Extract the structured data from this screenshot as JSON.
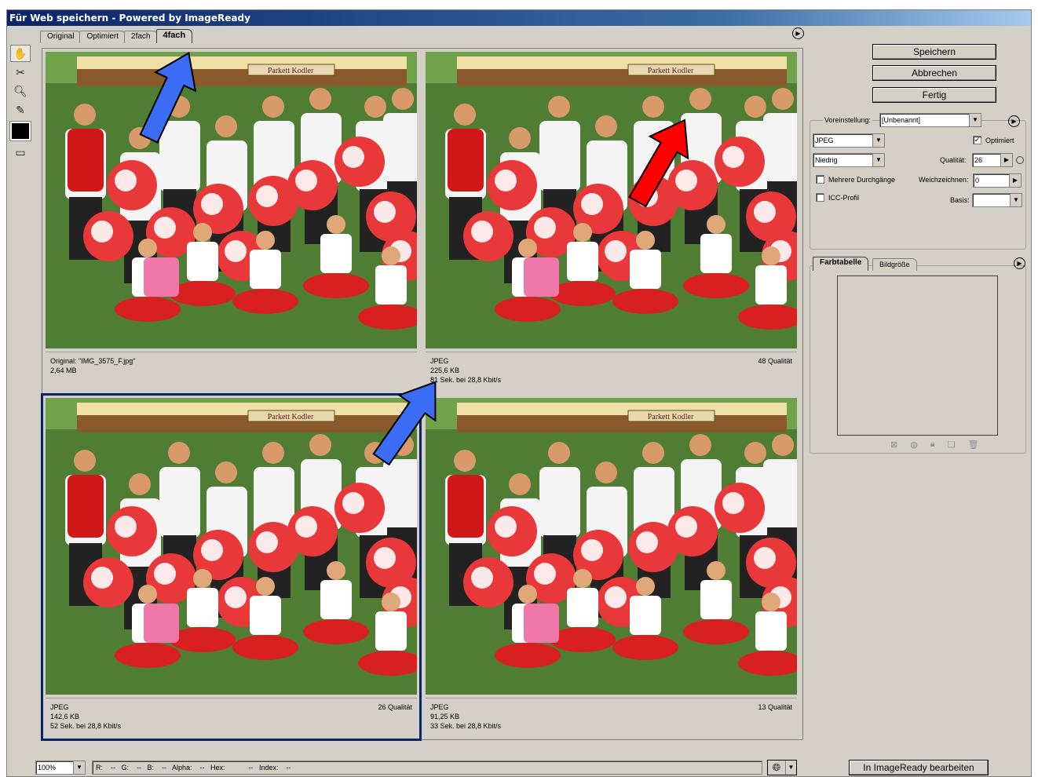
{
  "window": {
    "title": "Für Web speichern - Powered by ImageReady"
  },
  "tabs": [
    "Original",
    "Optimiert",
    "2fach",
    "4fach"
  ],
  "active_tab": "4fach",
  "panes": [
    {
      "line1": "Original: \"IMG_3575_F.jpg\"",
      "line2": "2,64 MB",
      "line3": "",
      "quality": ""
    },
    {
      "line1": "JPEG",
      "line2": "225,6 KB",
      "line3": "81 Sek. bei 28,8 Kbit/s",
      "quality": "48 Qualität"
    },
    {
      "line1": "JPEG",
      "line2": "142,6 KB",
      "line3": "52 Sek. bei 28,8 Kbit/s",
      "quality": "26 Qualität"
    },
    {
      "line1": "JPEG",
      "line2": "91,25 KB",
      "line3": "33 Sek. bei 28,8 Kbit/s",
      "quality": "13 Qualität"
    }
  ],
  "buttons": {
    "save": "Speichern",
    "cancel": "Abbrechen",
    "done": "Fertig",
    "imageready": "In ImageReady bearbeiten"
  },
  "settings": {
    "preset_label": "Voreinstellung:",
    "preset_value": "[Unbenannt]",
    "format": "JPEG",
    "quality_preset": "Niedrig",
    "optimized_label": "Optimiert",
    "optimized_checked": true,
    "quality_label": "Qualität:",
    "quality_value": "26",
    "progressive_label": "Mehrere Durchgänge",
    "blur_label": "Weichzeichnen:",
    "blur_value": "0",
    "icc_label": "ICC-Profil",
    "matte_label": "Basis:"
  },
  "lower_tabs": [
    "Farbtabelle",
    "Bildgröße"
  ],
  "status": {
    "zoom": "100%",
    "readout": "R:    --   G:    --   B:    --   Alpha:    --   Hex:            --   Index:    --"
  },
  "photo_signs": {
    "banner": "Parkett Kodler"
  },
  "overlay_arrow_colors": {
    "blue": "#3a6cf5",
    "red": "#ff0000"
  }
}
